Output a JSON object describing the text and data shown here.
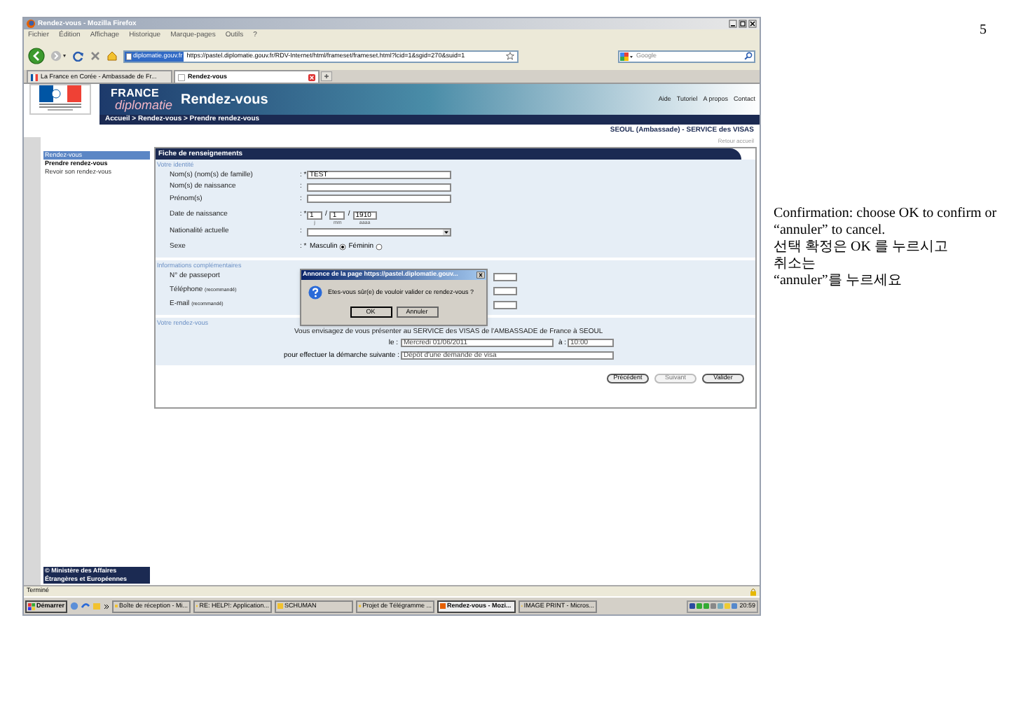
{
  "document": {
    "page_number": "5",
    "note": "Confirmation: choose OK to confirm or “annuler” to cancel.",
    "note_lines": [
      "선택 확정은 OK 를 누르시고",
      "취소는",
      "“annuler”를 누르세요"
    ]
  },
  "browser": {
    "title": "Rendez-vous - Mozilla Firefox",
    "menu": [
      "Fichier",
      "Édition",
      "Affichage",
      "Historique",
      "Marque-pages",
      "Outils",
      "?"
    ],
    "url_domain": "diplomatie.gouv.fr",
    "url": "https://pastel.diplomatie.gouv.fr/RDV-Internet/html/frameset/frameset.html?lcid=1&sgid=270&suid=1",
    "search_placeholder": "Google",
    "tabs": [
      {
        "label": "La France en Corée - Ambassade de Fr...",
        "selected": false
      },
      {
        "label": "Rendez-vous",
        "selected": true
      }
    ],
    "status": "Terminé"
  },
  "site": {
    "brand_top": "FRANCE",
    "brand_bottom": "diplomatie",
    "section": "Rendez-vous",
    "links": [
      "Aide",
      "Tutoriel",
      "A propos",
      "Contact"
    ],
    "breadcrumb": "Accueil > Rendez-vous > Prendre rendez-vous",
    "location": "SEOUL (Ambassade) - SERVICE des VISAS",
    "back_link": "Retour accueil",
    "sidebar": {
      "title": "Rendez-vous",
      "items": [
        {
          "label": "Prendre rendez-vous",
          "selected": true
        },
        {
          "label": "Revoir son rendez-vous",
          "selected": false
        }
      ]
    },
    "footer": "© Ministère des Affaires Étrangères et Européennes"
  },
  "form": {
    "title": "Fiche de renseignements",
    "sections": [
      {
        "title": "Votre identité",
        "fields": [
          {
            "kind": "text",
            "label": "Nom(s) (nom(s) de famille)",
            "marker": ": *",
            "value": "TEST"
          },
          {
            "kind": "text",
            "label": "Nom(s) de naissance",
            "marker": ":"
          },
          {
            "kind": "text",
            "label": "Prénom(s)",
            "marker": ":"
          },
          {
            "kind": "date",
            "label": "Date de naissance",
            "marker": ": *",
            "parts": [
              {
                "value": "1",
                "hint": "j"
              },
              {
                "sep": "/",
                "value": "1",
                "hint": "mm"
              },
              {
                "sep": "/",
                "value": "1910",
                "hint": "aaaa"
              }
            ]
          },
          {
            "kind": "select",
            "label": "Nationalité actuelle",
            "marker": ":"
          },
          {
            "kind": "radio",
            "label": "Sexe",
            "marker": ": *",
            "options": [
              {
                "label": "Masculin",
                "selected": true
              },
              {
                "label": "Féminin",
                "selected": false
              }
            ]
          }
        ]
      },
      {
        "title": "Informations complémentaires",
        "fields": [
          {
            "kind": "wide",
            "label": "N° de passeport"
          },
          {
            "kind": "wide",
            "label": "Téléphone",
            "note": "(recommandé)"
          },
          {
            "kind": "wide",
            "label": "E-mail",
            "note": "(recommandé)"
          }
        ]
      },
      {
        "title": "Votre rendez-vous",
        "fields": [
          {
            "kind": "intro",
            "label": "Vous envisagez de vous présenter au SERVICE des VISAS de l'AMBASSADE de France à SEOUL"
          },
          {
            "kind": "when",
            "label": "le :",
            "value": "Mercredi 01/06/2011",
            "time_label": "à :",
            "time": "10:00"
          },
          {
            "kind": "task",
            "label": "pour effectuer la démarche suivante :",
            "value": "Dépôt d'une demande de visa"
          }
        ]
      }
    ],
    "buttons": [
      {
        "label": "Précédent",
        "disabled": false
      },
      {
        "label": "Suivant",
        "disabled": true
      },
      {
        "label": "Valider",
        "disabled": false
      }
    ]
  },
  "dialog": {
    "title": "Annonce de la page https://pastel.diplomatie.gouv...",
    "message": "Etes-vous sûr(e) de vouloir valider ce rendez-vous ?",
    "buttons": [
      "OK",
      "Annuler"
    ]
  },
  "taskbar": {
    "start": "Démarrer",
    "items": [
      {
        "label": "Boîte de réception - Mi...",
        "selected": false
      },
      {
        "label": "RE: HELP!: Application...",
        "selected": false
      },
      {
        "label": "SCHUMAN",
        "selected": false
      },
      {
        "label": "Projet de Télégramme ...",
        "selected": false
      },
      {
        "label": "Rendez-vous - Mozi...",
        "selected": true
      },
      {
        "label": "IMAGE PRINT - Micros...",
        "selected": false
      }
    ],
    "clock": "20:59"
  }
}
